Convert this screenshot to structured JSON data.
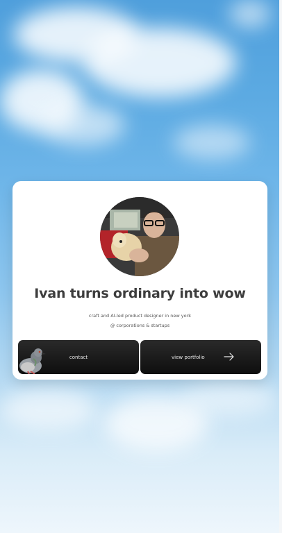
{
  "hero": {
    "headline": "Ivan turns ordinary into wow",
    "tagline": "craft and AI-led product designer in new york",
    "audience": "@ corporations & startups"
  },
  "actions": {
    "contact_label": "contact",
    "portfolio_label": "view portfolio"
  },
  "icons": {
    "contact": "pigeon-icon",
    "portfolio": "arrow-right-icon"
  },
  "colors": {
    "sky_top": "#4f9fdc",
    "sky_bottom": "#eef6fc",
    "card": "#ffffff",
    "headline": "#3d3d3d",
    "button": "#141414"
  }
}
